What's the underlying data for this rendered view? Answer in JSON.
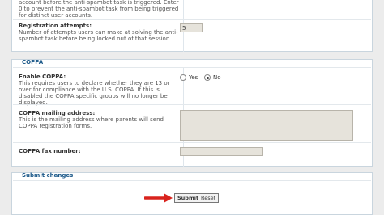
{
  "top_section": {
    "spambot_desc": "account before the anti-spambot task is triggered. Enter 0 to prevent the anti-spambot task from being triggered for distinct user accounts.",
    "registration_attempts_title": "Registration attempts:",
    "registration_attempts_desc": "Number of attempts users can make at solving the anti-spambot task before being locked out of that session.",
    "registration_attempts_value": "5"
  },
  "coppa": {
    "legend": "COPPA",
    "enable_title": "Enable COPPA:",
    "enable_desc": "This requires users to declare whether they are 13 or over for compliance with the U.S. COPPA. If this is disabled the COPPA specific groups will no longer be displayed.",
    "yes_label": "Yes",
    "no_label": "No",
    "selected": "No",
    "mailing_title": "COPPA mailing address:",
    "mailing_desc": "This is the mailing address where parents will send COPPA registration forms.",
    "mailing_value": "",
    "fax_title": "COPPA fax number:",
    "fax_value": ""
  },
  "submit_section": {
    "legend": "Submit changes",
    "submit_label": "Submit",
    "reset_label": "Reset"
  },
  "colors": {
    "legend": "#1d5a8a",
    "arrow": "#d9231d"
  }
}
